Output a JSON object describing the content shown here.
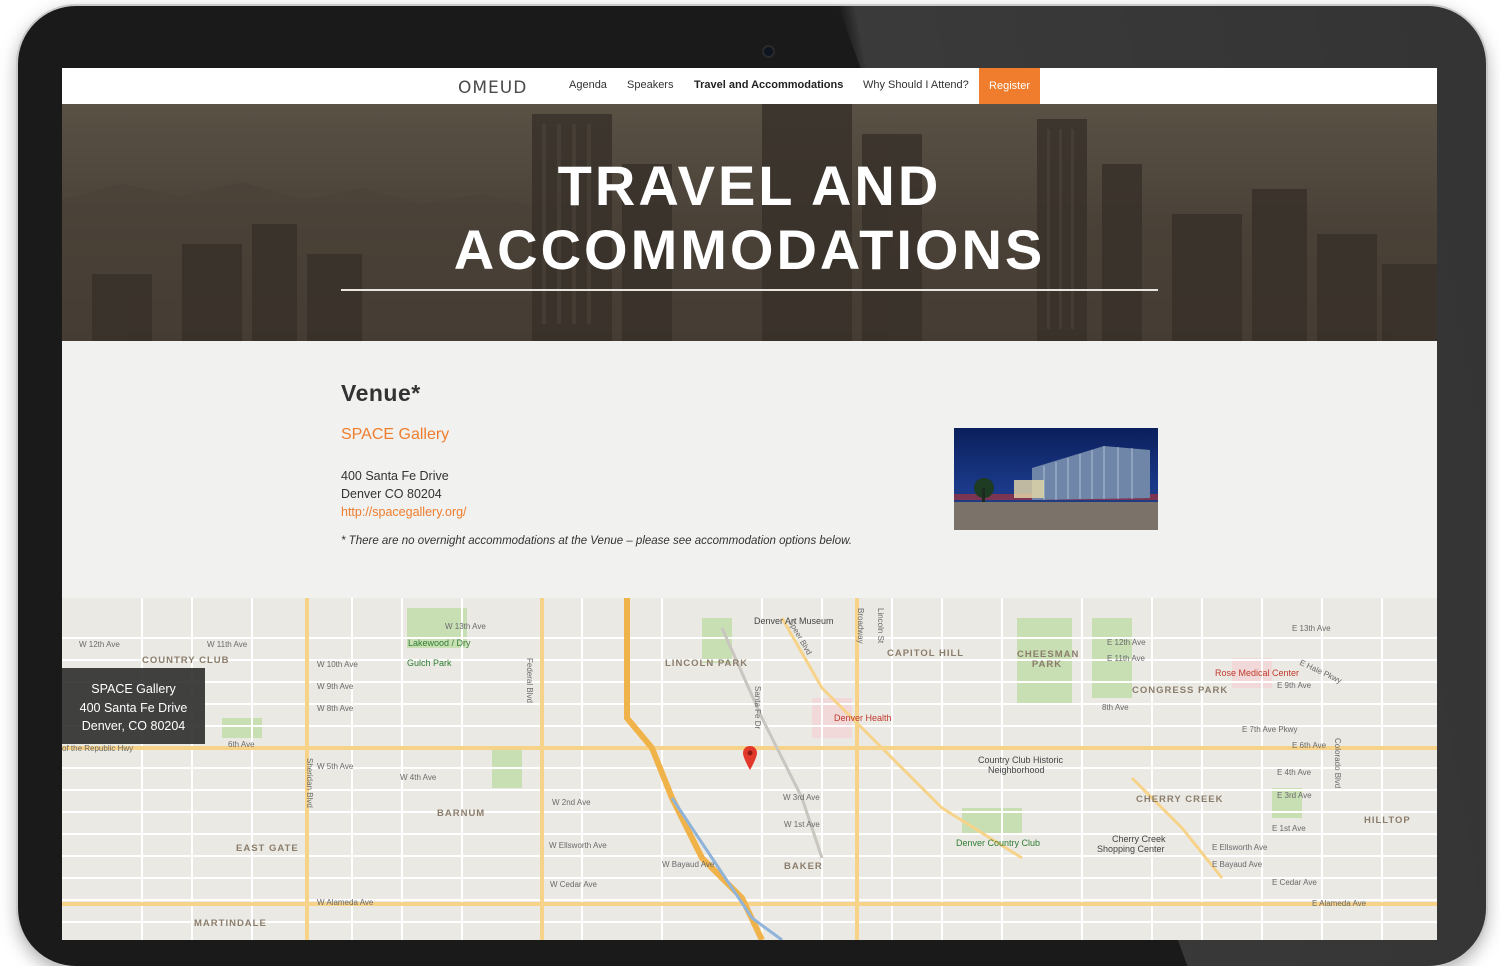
{
  "nav": {
    "logo": "OMEUD",
    "links": [
      "Agenda",
      "Speakers",
      "Travel and Accommodations",
      "Why Should I Attend?"
    ],
    "register": "Register"
  },
  "hero": {
    "title_line1": "TRAVEL AND",
    "title_line2": "ACCOMMODATIONS"
  },
  "venue": {
    "heading": "Venue*",
    "name": "SPACE Gallery",
    "address_line1": "400 Santa Fe Drive",
    "address_line2": "Denver CO 80204",
    "url": "http://spacegallery.org/",
    "note": "* There are no overnight accommodations at the Venue – please see accommodation options below."
  },
  "map": {
    "infobox": {
      "line1": "SPACE Gallery",
      "line2": "400 Santa Fe Drive",
      "line3": "Denver, CO 80204"
    },
    "areas": [
      "COUNTRY CLUB",
      "LINCOLN PARK",
      "CAPITOL HILL",
      "CHEESMAN PARK",
      "CONGRESS PARK",
      "BARNUM",
      "EAST GATE",
      "BAKER",
      "CHERRY CREEK",
      "HILLTOP",
      "MARTINDALE"
    ],
    "pois": [
      "Denver Art Museum",
      "Denver Health",
      "Rose Medical Center",
      "Country Club Historic",
      "Neighborhood",
      "Denver Country Club",
      "Cherry Creek",
      "Shopping Center",
      "Lakewood / Dry",
      "Gulch Park"
    ],
    "streets": [
      "W 13th Ave",
      "W 12th Ave",
      "W 11th Ave",
      "W 10th Ave",
      "W 9th Ave",
      "W 8th Ave",
      "6th Ave",
      "W 5th Ave",
      "W 4th Ave",
      "W 3rd Ave",
      "W 2nd Ave",
      "W 1st Ave",
      "W Bayaud Ave",
      "W Cedar Ave",
      "W Alameda Ave",
      "E 13th Ave",
      "E 12th Ave",
      "E 11th Ave",
      "E 9th Ave",
      "8th Ave",
      "E 7th Ave Pkwy",
      "E 6th Ave",
      "E 4th Ave",
      "E 3rd Ave",
      "E 1st Ave",
      "E Ellsworth Ave",
      "E Bayaud Ave",
      "E Cedar Ave",
      "E Alameda Ave",
      "Federal Blvd",
      "Sheridan Blvd",
      "Speer Blvd",
      "Lincoln St",
      "Broadway",
      "Colorado Blvd",
      "W Ellsworth Ave",
      "of the Republic Hwy",
      "Santa Fe Dr",
      "E Hale Pkwy"
    ]
  },
  "colors": {
    "accent": "#ef7d2d",
    "hero_bg": "#433b31",
    "page_bg": "#f1f1ef"
  }
}
